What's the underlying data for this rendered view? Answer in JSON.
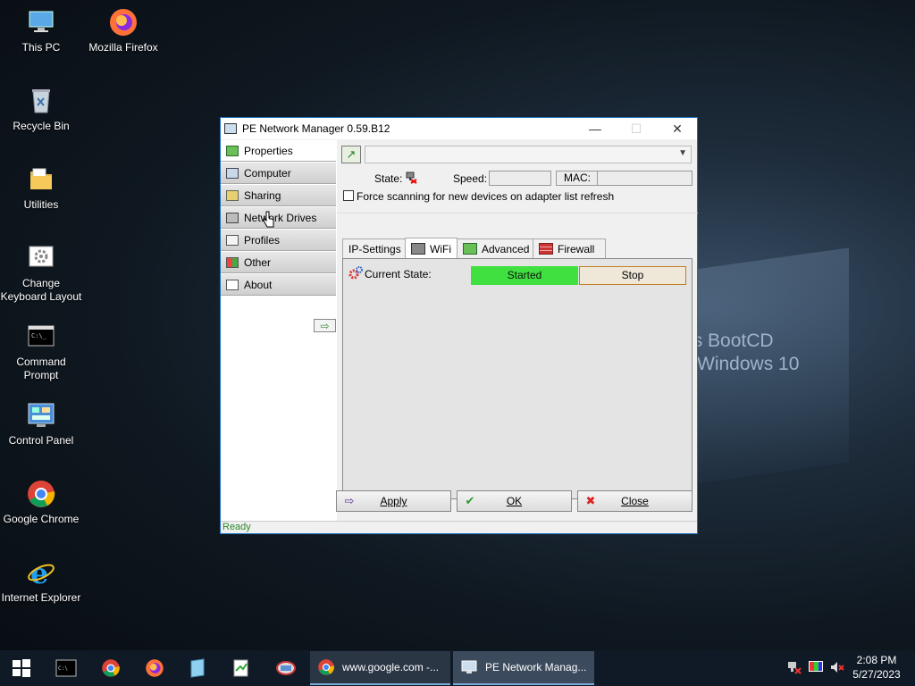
{
  "desktop": {
    "icons": [
      {
        "label": "This PC"
      },
      {
        "label": "Mozilla Firefox"
      },
      {
        "label": "Recycle Bin"
      },
      {
        "label": "Utilities"
      },
      {
        "label": "Change Keyboard Layout"
      },
      {
        "label": "Command Prompt"
      },
      {
        "label": "Control Panel"
      },
      {
        "label": "Google Chrome"
      },
      {
        "label": "Internet Explorer"
      }
    ],
    "wallpaper_text_1": "n's BootCD",
    "wallpaper_text_2": "Windows 10"
  },
  "window": {
    "title": "PE Network Manager 0.59.B12",
    "nav": [
      {
        "label": "Properties"
      },
      {
        "label": "Computer"
      },
      {
        "label": "Sharing"
      },
      {
        "label": "Network Drives"
      },
      {
        "label": "Profiles"
      },
      {
        "label": "Other"
      },
      {
        "label": "About"
      }
    ],
    "adapter_value": "",
    "state_label": "State:",
    "speed_label": "Speed:",
    "speed_value": "",
    "mac_label": "MAC:",
    "mac_value": "",
    "force_scan_label": "Force scanning for new devices on adapter list refresh",
    "force_scan_checked": false,
    "tabs": [
      {
        "label": "IP-Settings"
      },
      {
        "label": "WiFi"
      },
      {
        "label": "Advanced"
      },
      {
        "label": "Firewall"
      }
    ],
    "active_tab": "WiFi",
    "current_state_label": "Current State:",
    "current_state_value": "Started",
    "stop_label": "Stop",
    "buttons": {
      "apply": "Apply",
      "ok": "OK",
      "close": "Close"
    },
    "status": "Ready"
  },
  "taskbar": {
    "tasks": [
      {
        "label": "www.google.com -..."
      },
      {
        "label": "PE Network Manag..."
      }
    ],
    "time": "2:08 PM",
    "date": "5/27/2023"
  },
  "colors": {
    "started": "#3fe03f",
    "title_border": "#1b70c4",
    "status_text": "#2a8a2a"
  }
}
